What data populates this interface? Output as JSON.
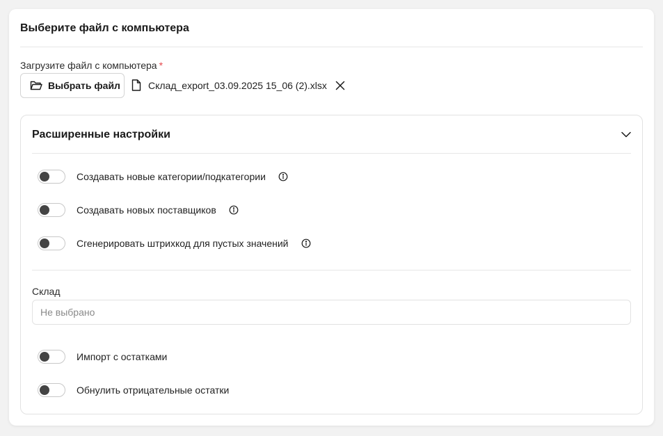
{
  "card": {
    "title": "Выберите файл с компьютера"
  },
  "upload": {
    "label": "Загрузите файл с компьютера",
    "required_mark": "*",
    "button_label": "Выбрать файл",
    "file_name": "Склад_export_03.09.2025 15_06 (2).xlsx"
  },
  "advanced": {
    "title": "Расширенные настройки",
    "expanded": true,
    "toggles": [
      {
        "label": "Создавать новые категории/подкатегории",
        "on": false,
        "has_info": true
      },
      {
        "label": "Создавать новых поставщиков",
        "on": false,
        "has_info": true
      },
      {
        "label": "Сгенерировать штрихкод для пустых значений",
        "on": false,
        "has_info": true
      }
    ],
    "warehouse": {
      "label": "Склад",
      "placeholder": "Не выбрано"
    },
    "stock_toggles": [
      {
        "label": "Импорт с остатками",
        "on": false
      },
      {
        "label": "Обнулить отрицательные остатки",
        "on": false
      }
    ]
  },
  "colors": {
    "required": "#e5484d",
    "switch_knob": "#444444",
    "border": "#e2e2e2"
  },
  "icons": {
    "choose_button": "folder-open-icon",
    "file": "file-icon",
    "remove": "close-icon",
    "collapse": "chevron-down-icon",
    "info": "info-icon"
  }
}
